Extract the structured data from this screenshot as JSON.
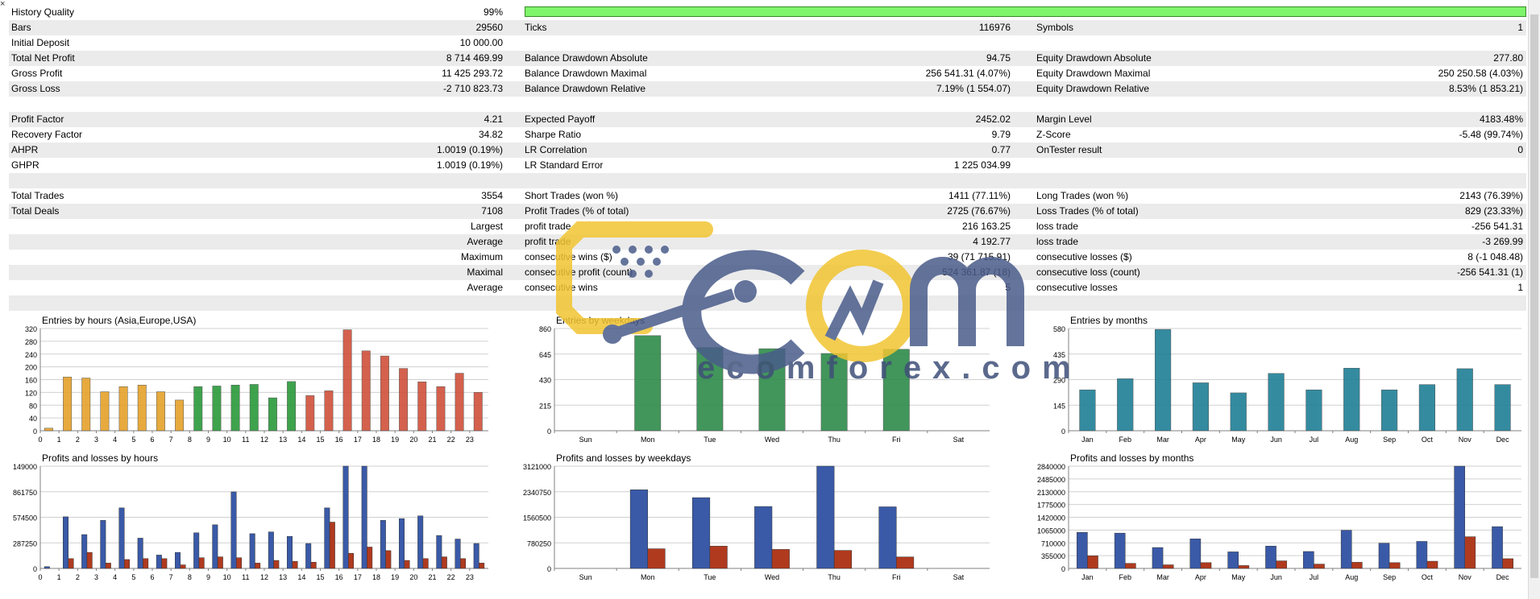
{
  "stats": {
    "quality": {
      "label": "History Quality",
      "value": "99%"
    },
    "rows": [
      {
        "c1": "Bars",
        "v1": "29560",
        "c2": "Ticks",
        "v2": "116976",
        "c3": "Symbols",
        "v3": "1"
      },
      {
        "c1": "Initial Deposit",
        "v1": "10 000.00",
        "c2": "",
        "v2": "",
        "c3": "",
        "v3": ""
      },
      {
        "c1": "Total Net Profit",
        "v1": "8 714 469.99",
        "c2": "Balance Drawdown Absolute",
        "v2": "94.75",
        "c3": "Equity Drawdown Absolute",
        "v3": "277.80"
      },
      {
        "c1": "Gross Profit",
        "v1": "11 425 293.72",
        "c2": "Balance Drawdown Maximal",
        "v2": "256 541.31 (4.07%)",
        "c3": "Equity Drawdown Maximal",
        "v3": "250 250.58 (4.03%)"
      },
      {
        "c1": "Gross Loss",
        "v1": "-2 710 823.73",
        "c2": "Balance Drawdown Relative",
        "v2": "7.19% (1 554.07)",
        "c3": "Equity Drawdown Relative",
        "v3": "8.53% (1 853.21)"
      },
      {
        "c1": "",
        "v1": "",
        "c2": "",
        "v2": "",
        "c3": "",
        "v3": ""
      },
      {
        "c1": "Profit Factor",
        "v1": "4.21",
        "c2": "Expected Payoff",
        "v2": "2452.02",
        "c3": "Margin Level",
        "v3": "4183.48%"
      },
      {
        "c1": "Recovery Factor",
        "v1": "34.82",
        "c2": "Sharpe Ratio",
        "v2": "9.79",
        "c3": "Z-Score",
        "v3": "-5.48 (99.74%)"
      },
      {
        "c1": "AHPR",
        "v1": "1.0019 (0.19%)",
        "c2": "LR Correlation",
        "v2": "0.77",
        "c3": "OnTester result",
        "v3": "0"
      },
      {
        "c1": "GHPR",
        "v1": "1.0019 (0.19%)",
        "c2": "LR Standard Error",
        "v2": "1 225 034.99",
        "c3": "",
        "v3": ""
      },
      {
        "c1": "",
        "v1": "",
        "c2": "",
        "v2": "",
        "c3": "",
        "v3": ""
      },
      {
        "c1": "Total Trades",
        "v1": "3554",
        "c2": "Short Trades (won %)",
        "v2": "1411 (77.11%)",
        "c3": "Long Trades (won %)",
        "v3": "2143 (76.39%)"
      },
      {
        "c1": "Total Deals",
        "v1": "7108",
        "c2": "Profit Trades (% of total)",
        "v2": "2725 (76.67%)",
        "c3": "Loss Trades (% of total)",
        "v3": "829 (23.33%)"
      },
      {
        "l1": "Largest",
        "c2": "profit trade",
        "v2": "216 163.25",
        "c3": "loss trade",
        "v3": "-256 541.31"
      },
      {
        "l1": "Average",
        "c2": "profit trade",
        "v2": "4 192.77",
        "c3": "loss trade",
        "v3": "-3 269.99"
      },
      {
        "l1": "Maximum",
        "c2": "consecutive wins ($)",
        "v2": "39 (71 715.91)",
        "c3": "consecutive losses ($)",
        "v3": "8 (-1 048.48)"
      },
      {
        "l1": "Maximal",
        "c2": "consecutive profit (count)",
        "v2": "524 361.87 (18)",
        "c3": "consecutive loss (count)",
        "v3": "-256 541.31 (1)"
      },
      {
        "l1": "Average",
        "c2": "consecutive wins",
        "v2": "5",
        "c3": "consecutive losses",
        "v3": "1"
      },
      {
        "c1": "",
        "v1": "",
        "c2": "",
        "v2": "",
        "c3": "",
        "v3": ""
      }
    ]
  },
  "watermark": {
    "brand": "ecomforex.com"
  },
  "colors": {
    "quality_bar": "#7ef56a",
    "blue": "#3a5aa8",
    "red": "#b03a1e",
    "green": "#2e8b4a",
    "teal": "#1f7f96"
  },
  "chart_data": [
    {
      "type": "bar",
      "title": "Entries by hours (Asia,Europe,USA)",
      "categories": [
        "0",
        "1",
        "2",
        "3",
        "4",
        "5",
        "6",
        "7",
        "8",
        "9",
        "10",
        "11",
        "12",
        "13",
        "14",
        "15",
        "16",
        "17",
        "18",
        "19",
        "20",
        "21",
        "22",
        "23"
      ],
      "values": [
        8,
        168,
        165,
        122,
        138,
        143,
        122,
        96,
        138,
        140,
        143,
        145,
        103,
        154,
        110,
        125,
        316,
        250,
        234,
        195,
        153,
        138,
        180,
        120
      ],
      "yticks": [
        "0",
        "40",
        "80",
        "120",
        "160",
        "200",
        "240",
        "280",
        "320"
      ],
      "ylim": [
        0,
        320
      ]
    },
    {
      "type": "bar",
      "title": "Entries by weekdays",
      "categories": [
        "Sun",
        "Mon",
        "Tue",
        "Wed",
        "Thu",
        "Fri",
        "Sat"
      ],
      "values": [
        0,
        800,
        700,
        690,
        650,
        685,
        0
      ],
      "yticks": [
        "0",
        "215",
        "430",
        "645",
        "860"
      ],
      "ylim": [
        0,
        860
      ]
    },
    {
      "type": "bar",
      "title": "Entries by months",
      "categories": [
        "Jan",
        "Feb",
        "Mar",
        "Apr",
        "May",
        "Jun",
        "Jul",
        "Aug",
        "Sep",
        "Oct",
        "Nov",
        "Dec"
      ],
      "values": [
        232,
        295,
        575,
        272,
        215,
        325,
        232,
        355,
        232,
        262,
        352,
        262
      ],
      "yticks": [
        "0",
        "145",
        "290",
        "435",
        "580"
      ],
      "ylim": [
        0,
        580
      ]
    },
    {
      "type": "bar",
      "title": "Profits and losses by hours",
      "categories": [
        "0",
        "1",
        "2",
        "3",
        "4",
        "5",
        "6",
        "7",
        "8",
        "9",
        "10",
        "11",
        "12",
        "13",
        "14",
        "15",
        "16",
        "17",
        "18",
        "19",
        "20",
        "21",
        "22",
        "23"
      ],
      "series": [
        {
          "values": [
            20000,
            580000,
            380000,
            540000,
            680000,
            340000,
            150000,
            180000,
            400000,
            490000,
            860000,
            390000,
            410000,
            360000,
            280000,
            680000,
            1700000,
            1850000,
            540000,
            560000,
            590000,
            370000,
            330000,
            280000
          ]
        },
        {
          "values": [
            0,
            110000,
            180000,
            60000,
            100000,
            110000,
            110000,
            40000,
            120000,
            130000,
            120000,
            60000,
            90000,
            80000,
            70000,
            520000,
            170000,
            240000,
            200000,
            90000,
            110000,
            130000,
            110000,
            60000
          ]
        }
      ],
      "yticks": [
        "0",
        "287250",
        "574500",
        "861750",
        "149000"
      ],
      "ylim": [
        0,
        1149000
      ]
    },
    {
      "type": "bar",
      "title": "Profits and losses by weekdays",
      "categories": [
        "Sun",
        "Mon",
        "Tue",
        "Wed",
        "Thu",
        "Fri",
        "Sat"
      ],
      "series": [
        {
          "values": [
            0,
            2400000,
            2160000,
            1890000,
            3121000,
            1880000,
            0
          ]
        },
        {
          "values": [
            0,
            600000,
            680000,
            580000,
            550000,
            350000,
            0
          ]
        }
      ],
      "yticks": [
        "0",
        "780250",
        "1560500",
        "2340750",
        "3121000"
      ],
      "ylim": [
        0,
        3121000
      ]
    },
    {
      "type": "bar",
      "title": "Profits and losses by months",
      "categories": [
        "Jan",
        "Feb",
        "Mar",
        "Apr",
        "May",
        "Jun",
        "Jul",
        "Aug",
        "Sep",
        "Oct",
        "Nov",
        "Dec"
      ],
      "series": [
        {
          "values": [
            1000000,
            980000,
            580000,
            820000,
            460000,
            620000,
            470000,
            1060000,
            700000,
            750000,
            2840000,
            1160000
          ]
        },
        {
          "values": [
            350000,
            140000,
            100000,
            160000,
            80000,
            210000,
            120000,
            170000,
            160000,
            200000,
            880000,
            270000
          ]
        }
      ],
      "yticks": [
        "0",
        "355000",
        "710000",
        "1065000",
        "1420000",
        "1775000",
        "2130000",
        "2485000",
        "2840000"
      ],
      "ylim": [
        0,
        2840000
      ]
    }
  ]
}
